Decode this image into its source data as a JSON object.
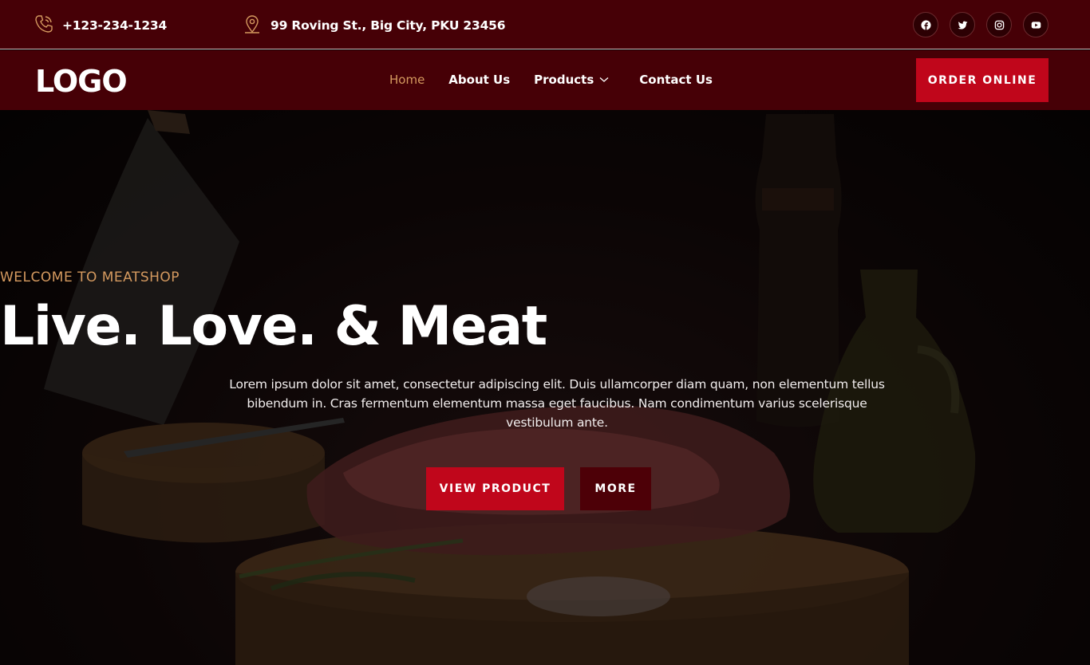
{
  "topbar": {
    "phone": "+123-234-1234",
    "address": "99 Roving St., Big City, PKU 23456",
    "phone_icon": "phone-icon",
    "address_icon": "map-pin-icon",
    "socials": [
      "facebook-icon",
      "twitter-icon",
      "instagram-icon",
      "youtube-icon"
    ]
  },
  "nav": {
    "logo": "LOGO",
    "items": [
      {
        "label": "Home",
        "active": true
      },
      {
        "label": "About Us"
      },
      {
        "label": "Products",
        "has_dropdown": true
      },
      {
        "label": "Contact Us"
      }
    ],
    "cta": "ORDER ONLINE"
  },
  "hero": {
    "eyebrow": "WELCOME TO MEATSHOP",
    "headline": "Live. Love. & Meat",
    "description": "Lorem ipsum dolor sit amet, consectetur adipiscing elit. Duis ullamcorper diam quam, non elementum tellus bibendum in. Cras fermentum elementum massa eget faucibus. Nam condimentum varius scelerisque vestibulum ante.",
    "primary_button": "VIEW PRODUCT",
    "secondary_button": "MORE"
  },
  "colors": {
    "bar_background": "#460006",
    "accent_red": "#c0061b",
    "accent_gold": "#d4995f",
    "dark_button": "#4d0007"
  }
}
